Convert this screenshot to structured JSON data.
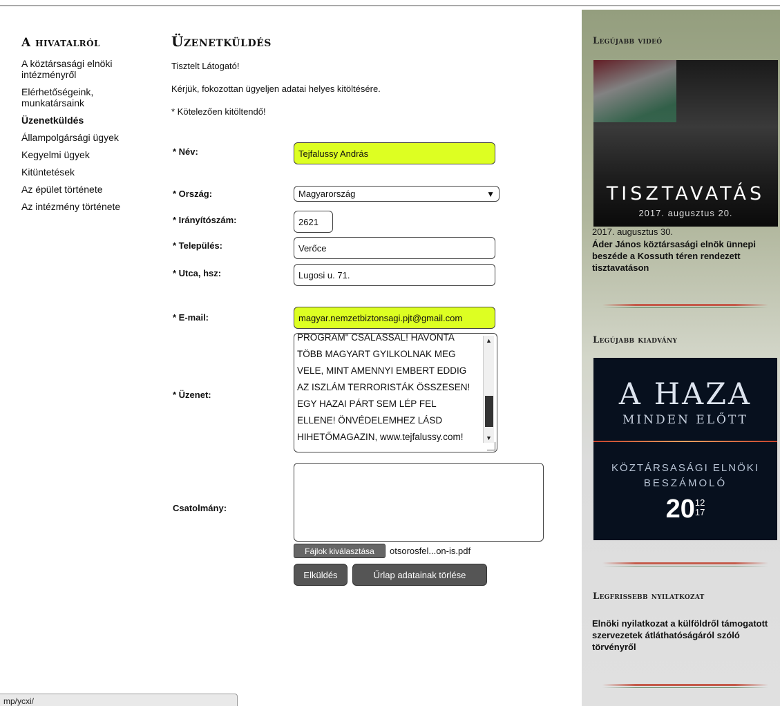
{
  "leftnav": {
    "heading": "A hivatalról",
    "items": [
      {
        "label": "A köztársasági elnöki intézményről"
      },
      {
        "label": "Elérhetőségeink, munkatársaink"
      },
      {
        "label": "Üzenetküldés"
      },
      {
        "label": "Állampolgársági ügyek"
      },
      {
        "label": "Kegyelmi ügyek"
      },
      {
        "label": "Kitüntetések"
      },
      {
        "label": "Az épület története"
      },
      {
        "label": "Az intézmény története"
      }
    ]
  },
  "main": {
    "title": "Üzenetküldés",
    "greeting": "Tisztelt Látogató!",
    "instruction": "Kérjük, fokozottan ügyeljen adatai helyes kitöltésére.",
    "required_note": "* Kötelezően kitöltendő!"
  },
  "form": {
    "name_label": "* Név:",
    "name_value": "Tejfalussy András",
    "country_label": "* Ország:",
    "country_value": "Magyarország",
    "zip_label": "* Irányítószám:",
    "zip_value": "2621",
    "city_label": "* Település:",
    "city_value": "Verőce",
    "street_label": "* Utca, hsz:",
    "street_value": "Lugosi u. 71.",
    "email_label": "* E-mail:",
    "email_value": "magyar.nemzetbiztonsagi.pjt@gmail.com",
    "message_label": "* Üzenet:",
    "message_lines": [
      "PROGRAM\" CSALÁSSAL! HAVONTA",
      "TÖBB MAGYART GYILKOLNAK MEG",
      "VELE, MINT AMENNYI EMBERT EDDIG",
      "AZ ISZLÁM TERRORISTÁK ÖSSZESEN!",
      "EGY HAZAI PÁRT SEM LÉP FEL",
      "ELLENE! ÖNVÉDELEMHEZ LÁSD",
      "HIHETŐMAGAZIN, www.tejfalussy.com!"
    ],
    "attachment_label": "Csatolmány:",
    "file_button": "Fájlok kiválasztása",
    "file_name": "otsorosfel...on-is.pdf",
    "submit_button": "Elküldés",
    "reset_button": "Űrlap adatainak törlése"
  },
  "statusbar": {
    "text": "mp/ycxi/"
  },
  "sidebar": {
    "video_heading": "Legújabb videó",
    "video_title": "TISZTAVATÁS",
    "video_subtitle": "2017. augusztus 20.",
    "video_date": "2017. augusztus 30.",
    "video_caption": "Áder János köztársasági elnök ünnepi beszéde a Kossuth téren rendezett tisztavatáson",
    "publication_heading": "Legújabb kiadvány",
    "pub_line1": "A HAZA",
    "pub_line2": "MINDEN ELŐTT",
    "pub_line3": "KÖZTÁRSASÁGI ELNÖKI",
    "pub_line4": "BESZÁMOLÓ",
    "pub_year": "20",
    "pub_year_top": "12",
    "pub_year_bottom": "17",
    "statement_heading": "Legfrissebb nyilatkozat",
    "statement_text": "Elnöki nyilatkozat a külföldről támogatott szervezetek átláthatóságáról szóló törvényről"
  },
  "colors": {
    "highlight_field": "#ddff22",
    "button": "#555555",
    "divider": "#c45a4a"
  }
}
